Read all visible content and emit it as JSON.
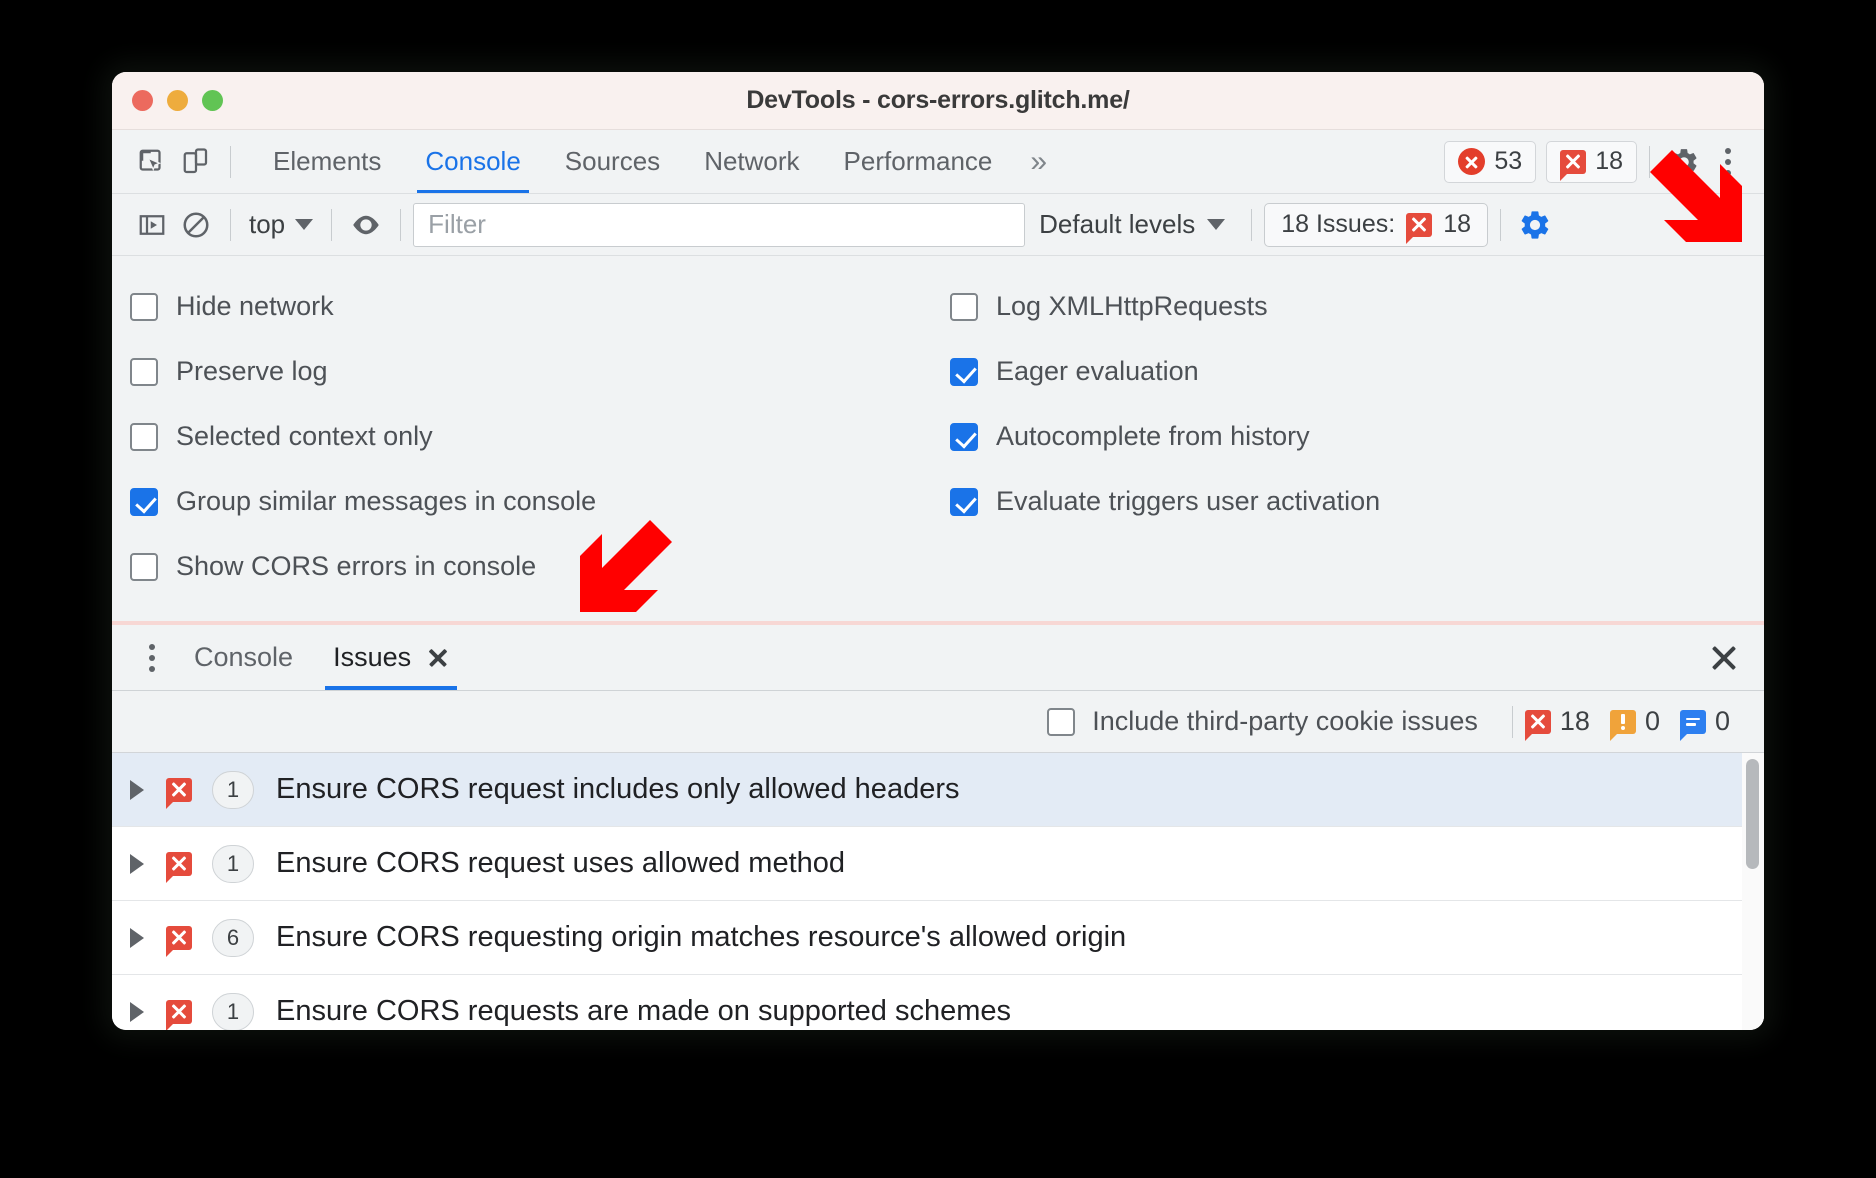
{
  "window": {
    "title": "DevTools - cors-errors.glitch.me/",
    "traffic_lights": [
      "close",
      "minimize",
      "maximize"
    ]
  },
  "tabbar": {
    "inspect_icon": "inspect-element-icon",
    "device_icon": "device-toolbar-icon",
    "tabs": [
      {
        "label": "Elements",
        "active": false
      },
      {
        "label": "Console",
        "active": true
      },
      {
        "label": "Sources",
        "active": false
      },
      {
        "label": "Network",
        "active": false
      },
      {
        "label": "Performance",
        "active": false
      }
    ],
    "more_tabs": "»",
    "error_badge": {
      "icon": "error-circle-icon",
      "count": "53"
    },
    "issue_badge": {
      "icon": "issue-bubble-icon",
      "count": "18"
    },
    "settings_icon": "gear-icon",
    "menu_icon": "kebab-menu-icon"
  },
  "console_toolbar": {
    "sidebar_icon": "console-sidebar-icon",
    "clear_icon": "clear-console-icon",
    "context": "top",
    "eye_icon": "live-expression-icon",
    "filter_placeholder": "Filter",
    "filter_value": "",
    "levels": "Default levels",
    "issues_button": {
      "label": "18 Issues:",
      "icon": "issue-bubble-icon",
      "count": "18"
    },
    "console_settings_icon": "gear-icon-active"
  },
  "settings_panel": {
    "left_column": [
      {
        "label": "Hide network",
        "checked": false
      },
      {
        "label": "Preserve log",
        "checked": false
      },
      {
        "label": "Selected context only",
        "checked": false
      },
      {
        "label": "Group similar messages in console",
        "checked": true
      },
      {
        "label": "Show CORS errors in console",
        "checked": false
      }
    ],
    "right_column": [
      {
        "label": "Log XMLHttpRequests",
        "checked": false
      },
      {
        "label": "Eager evaluation",
        "checked": true
      },
      {
        "label": "Autocomplete from history",
        "checked": true
      },
      {
        "label": "Evaluate triggers user activation",
        "checked": true
      }
    ]
  },
  "drawer": {
    "menu_icon": "kebab-menu-icon",
    "tabs": [
      {
        "label": "Console",
        "active": false,
        "closable": false
      },
      {
        "label": "Issues",
        "active": true,
        "closable": true
      }
    ],
    "close_icon": "close-drawer-icon",
    "filter_bar": {
      "third_party_label": "Include third-party cookie issues",
      "third_party_checked": false,
      "counts": [
        {
          "icon": "issue-error-bubble-icon",
          "value": "18",
          "color": "#e54b3c"
        },
        {
          "icon": "issue-warning-bubble-icon",
          "value": "0",
          "color": "#f0a33a"
        },
        {
          "icon": "issue-info-bubble-icon",
          "value": "0",
          "color": "#2d7ff0"
        }
      ]
    },
    "issues": [
      {
        "expand_icon": "chevron-right-icon",
        "severity_icon": "issue-error-bubble-icon",
        "count": "1",
        "title": "Ensure CORS request includes only allowed headers",
        "selected": true
      },
      {
        "expand_icon": "chevron-right-icon",
        "severity_icon": "issue-error-bubble-icon",
        "count": "1",
        "title": "Ensure CORS request uses allowed method",
        "selected": false
      },
      {
        "expand_icon": "chevron-right-icon",
        "severity_icon": "issue-error-bubble-icon",
        "count": "6",
        "title": "Ensure CORS requesting origin matches resource's allowed origin",
        "selected": false
      },
      {
        "expand_icon": "chevron-right-icon",
        "severity_icon": "issue-error-bubble-icon",
        "count": "1",
        "title": "Ensure CORS requests are made on supported schemes",
        "selected": false
      }
    ]
  },
  "annotations": [
    {
      "name": "arrow-pointing-to-console-settings-gear",
      "color": "#ff0000",
      "direction": "down-right"
    },
    {
      "name": "arrow-pointing-to-show-cors-errors-checkbox",
      "color": "#ff0000",
      "direction": "down-left"
    }
  ],
  "colors": {
    "accent": "#1a73e8",
    "error": "#e54b3c",
    "warning": "#f0a33a",
    "info": "#2d7ff0",
    "annotation": "#ff0000"
  }
}
